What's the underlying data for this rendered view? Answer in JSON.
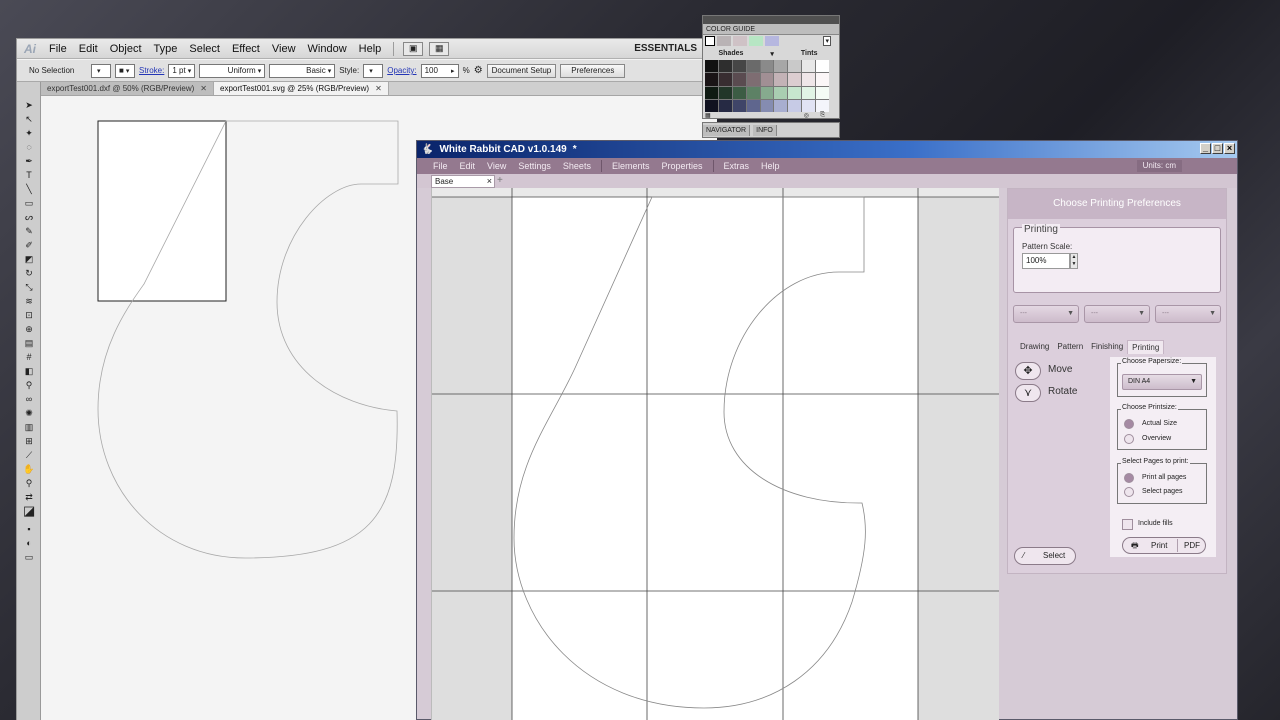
{
  "illustrator": {
    "logo": "Ai",
    "menus": [
      "File",
      "Edit",
      "Object",
      "Type",
      "Select",
      "Effect",
      "View",
      "Window",
      "Help"
    ],
    "workspace": "ESSENTIALS",
    "control": {
      "selection": "No Selection",
      "stroke_label": "Stroke:",
      "stroke_weight": "1 pt",
      "profile": "Uniform",
      "brush": "Basic",
      "style_label": "Style:",
      "opacity_label": "Opacity:",
      "opacity_value": "100",
      "opacity_unit": "%",
      "doc_setup": "Document Setup",
      "preferences": "Preferences"
    },
    "tabs": [
      {
        "label": "exportTest001.dxf @ 50% (RGB/Preview)",
        "active": false
      },
      {
        "label": "exportTest001.svg @ 25% (RGB/Preview)",
        "active": true
      }
    ]
  },
  "color_guide": {
    "title": "COLOR GUIDE",
    "shades_label": "Shades",
    "tints_label": "Tints",
    "grid_colors": [
      "#111111",
      "#2e2e2e",
      "#464646",
      "#6a6a6a",
      "#8a8a8a",
      "#a7a7a7",
      "#c9c9c9",
      "#e8e8e8",
      "#ffffff",
      "#1a1416",
      "#382d31",
      "#5a4b50",
      "#7e6d72",
      "#a18f94",
      "#c3b2b6",
      "#dccdd0",
      "#efe6e8",
      "#fbf6f7",
      "#0f1a12",
      "#223629",
      "#3c5c44",
      "#5d8165",
      "#86aa8e",
      "#a9cdb1",
      "#c7e6ce",
      "#e1f4e5",
      "#f4fbf5",
      "#101220",
      "#262a44",
      "#3f4568",
      "#5f668e",
      "#858cb1",
      "#a8aed0",
      "#c7cbe6",
      "#e1e3f4",
      "#f4f5fb"
    ],
    "swatches": [
      "#ffffff",
      "#b9b3b5",
      "#cfc2c6",
      "#b7e6c4",
      "#b6b7df"
    ]
  },
  "navigator": {
    "tabs": [
      "NAVIGATOR",
      "INFO"
    ]
  },
  "wrcad": {
    "title": "White Rabbit CAD v1.0.149",
    "dirty_marker": "*",
    "menus": [
      "File",
      "Edit",
      "View",
      "Settings",
      "Sheets",
      "Elements",
      "Properties",
      "Extras",
      "Help"
    ],
    "units": "Units:  cm",
    "sheet_tab": "Base",
    "panel": {
      "header": "Choose Printing Preferences",
      "printing_legend": "Printing",
      "pattern_scale_label": "Pattern Scale:",
      "pattern_scale_value": "100%",
      "dropdowns": [
        "---",
        "---",
        "---"
      ],
      "tabs": [
        "Drawing",
        "Pattern",
        "Finishing",
        "Printing"
      ],
      "active_tab": "Printing",
      "move": "Move",
      "rotate": "Rotate",
      "select": "Select",
      "papersize_caption": "Choose Papersize:",
      "papersize_value": "DIN A4",
      "printsize_caption": "Choose Printsize:",
      "printsize_options": [
        "Actual Size",
        "Overview"
      ],
      "pages_caption": "Select Pages to print:",
      "pages_options": [
        "Print all pages",
        "Select pages"
      ],
      "include_fills": "Include fills",
      "print_btn": "Print",
      "pdf_btn": "PDF"
    }
  }
}
